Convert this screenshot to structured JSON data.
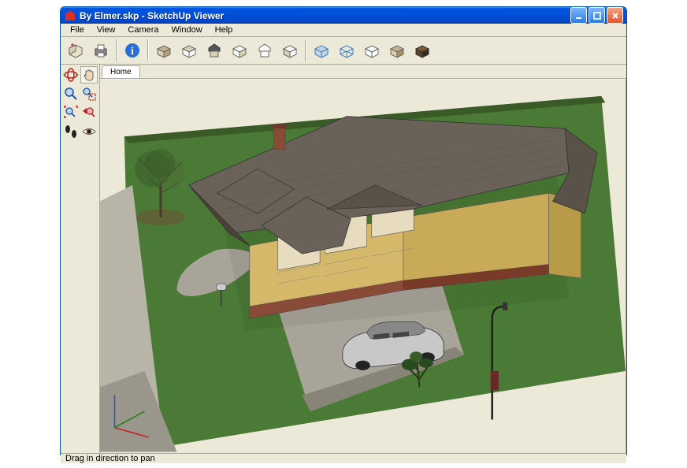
{
  "window": {
    "title": "By Elmer.skp - SketchUp Viewer",
    "appIcon": "sketchup-icon"
  },
  "menu": {
    "file": "File",
    "view": "View",
    "camera": "Camera",
    "window": "Window",
    "help": "Help"
  },
  "toolbar": {
    "open": "Open",
    "print": "Print",
    "info": "Info",
    "iso": "Iso",
    "top": "Top",
    "front": "Front",
    "right": "Right",
    "back": "Back",
    "left": "Left",
    "xray": "X-Ray",
    "wireframe": "Wireframe",
    "hidden": "Hidden Line",
    "shaded": "Shaded",
    "textured": "Shaded With Textures"
  },
  "sidebar": {
    "orbit": "Orbit",
    "pan": "Pan",
    "zoom": "Zoom",
    "zoomwindow": "Zoom Window",
    "zoomextents": "Zoom Extents",
    "previous": "Previous",
    "walk": "Walk",
    "lookaround": "Look Around"
  },
  "scene": {
    "tab1": "Home"
  },
  "status": {
    "hint": "Drag in direction to pan"
  }
}
